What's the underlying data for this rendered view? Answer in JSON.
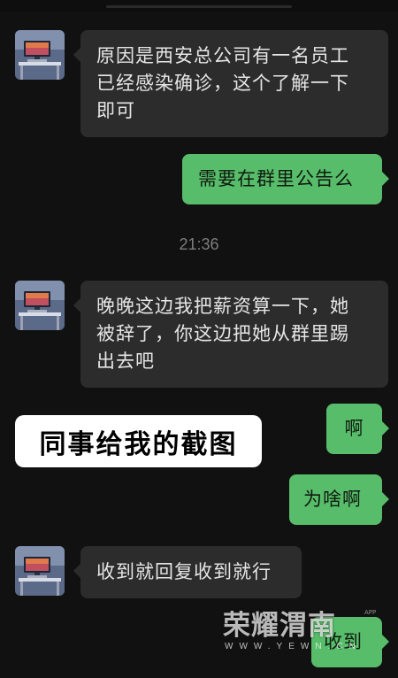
{
  "chat": {
    "messages": [
      {
        "direction": "incoming",
        "text": "原因是西安总公司有一名员工\n已经感染确诊，这个了解一下\n即可"
      },
      {
        "direction": "outgoing",
        "text": "需要在群里公告么"
      },
      {
        "direction": "incoming",
        "text": "晚晚这边我把薪资算一下，她\n被辞了，你这边把她从群里踢\n出去吧"
      },
      {
        "direction": "outgoing",
        "text": "啊"
      },
      {
        "direction": "outgoing",
        "text": "为啥啊"
      },
      {
        "direction": "incoming",
        "text": "收到就回复收到就行"
      },
      {
        "direction": "outgoing",
        "text": "收到"
      }
    ],
    "timestamp": "21:36"
  },
  "overlay": {
    "caption": "同事给我的截图"
  },
  "watermark": {
    "brand": "荣耀渭南",
    "site": "WWW.YEWN.CN",
    "app_tag": "APP"
  },
  "colors": {
    "background": "#111111",
    "incoming_bubble": "#2c2c2c",
    "outgoing_bubble": "#58bd6a",
    "timestamp_text": "#7d7d7d"
  },
  "icons": {
    "avatar": "desk-computer-avatar-icon"
  }
}
